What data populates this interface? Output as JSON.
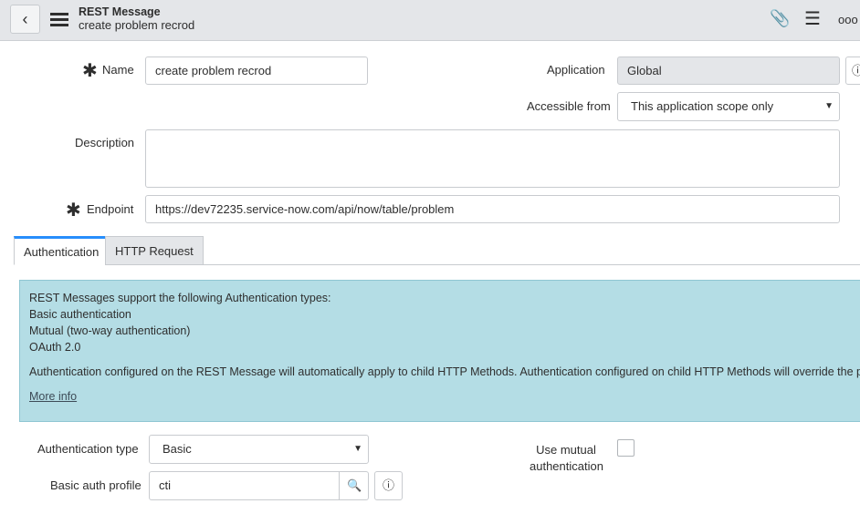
{
  "header": {
    "title": "REST Message",
    "subtitle": "create problem recrod",
    "more": "ooo"
  },
  "form": {
    "name_label": "Name",
    "name_value": "create problem recrod",
    "application_label": "Application",
    "application_value": "Global",
    "accessible_label": "Accessible from",
    "accessible_value": "This application scope only",
    "description_label": "Description",
    "description_value": "",
    "endpoint_label": "Endpoint",
    "endpoint_value": "https://dev72235.service-now.com/api/now/table/problem"
  },
  "tabs": [
    {
      "label": "Authentication",
      "active": true
    },
    {
      "label": "HTTP Request",
      "active": false
    }
  ],
  "info": {
    "lines": [
      "REST Messages support the following Authentication types:",
      "Basic authentication",
      "Mutual (two-way authentication)",
      "OAuth 2.0"
    ],
    "note": "Authentication configured on the REST Message will automatically apply to child HTTP Methods. Authentication configured on child HTTP Methods will override the parent",
    "link": "More info"
  },
  "auth": {
    "type_label": "Authentication type",
    "type_value": "Basic",
    "profile_label": "Basic auth profile",
    "profile_value": "cti",
    "mutual_label": "Use mutual authentication",
    "mutual_checked": false
  }
}
